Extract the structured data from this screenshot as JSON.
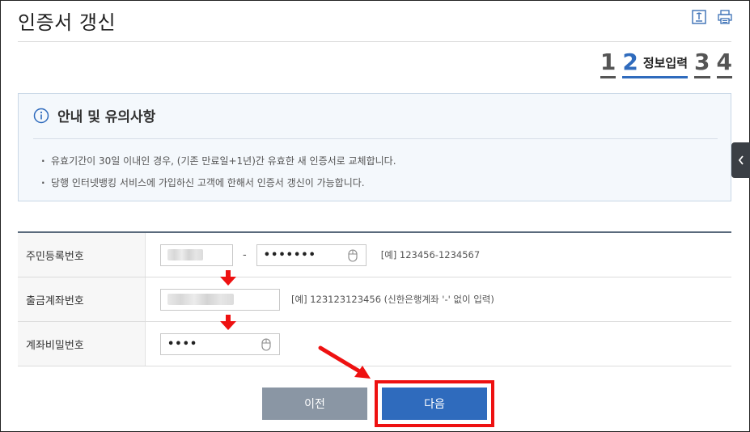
{
  "page": {
    "title": "인증서 갱신"
  },
  "toolbar": {
    "icons": [
      "download-icon",
      "print-icon"
    ]
  },
  "steps": {
    "items": [
      "1",
      "2",
      "3",
      "4"
    ],
    "active_index": 1,
    "active_label": "정보입력"
  },
  "notice": {
    "title": "안내 및 유의사항",
    "items": [
      "유효기간이 30일 이내인 경우, (기존 만료일+1년)간 유효한 새 인증서로 교체합니다.",
      "당행 인터넷뱅킹 서비스에 가입하신 고객에 한해서 인증서 갱신이 가능합니다."
    ]
  },
  "form": {
    "rows": [
      {
        "label": "주민등록번호",
        "dash": "-",
        "masked_value": "•••••••",
        "example": "[예] 123456-1234567"
      },
      {
        "label": "출금계좌번호",
        "example": "[예] 123123123456 (신한은행계좌 '-' 없이 입력)"
      },
      {
        "label": "계좌비밀번호",
        "masked_value": "••••"
      }
    ]
  },
  "buttons": {
    "prev": "이전",
    "next": "다음"
  },
  "colors": {
    "accent": "#2f6bbd",
    "prev_button": "#8a96a4",
    "annotation_red": "#ee1111",
    "notice_bg": "#f4f8fc"
  }
}
